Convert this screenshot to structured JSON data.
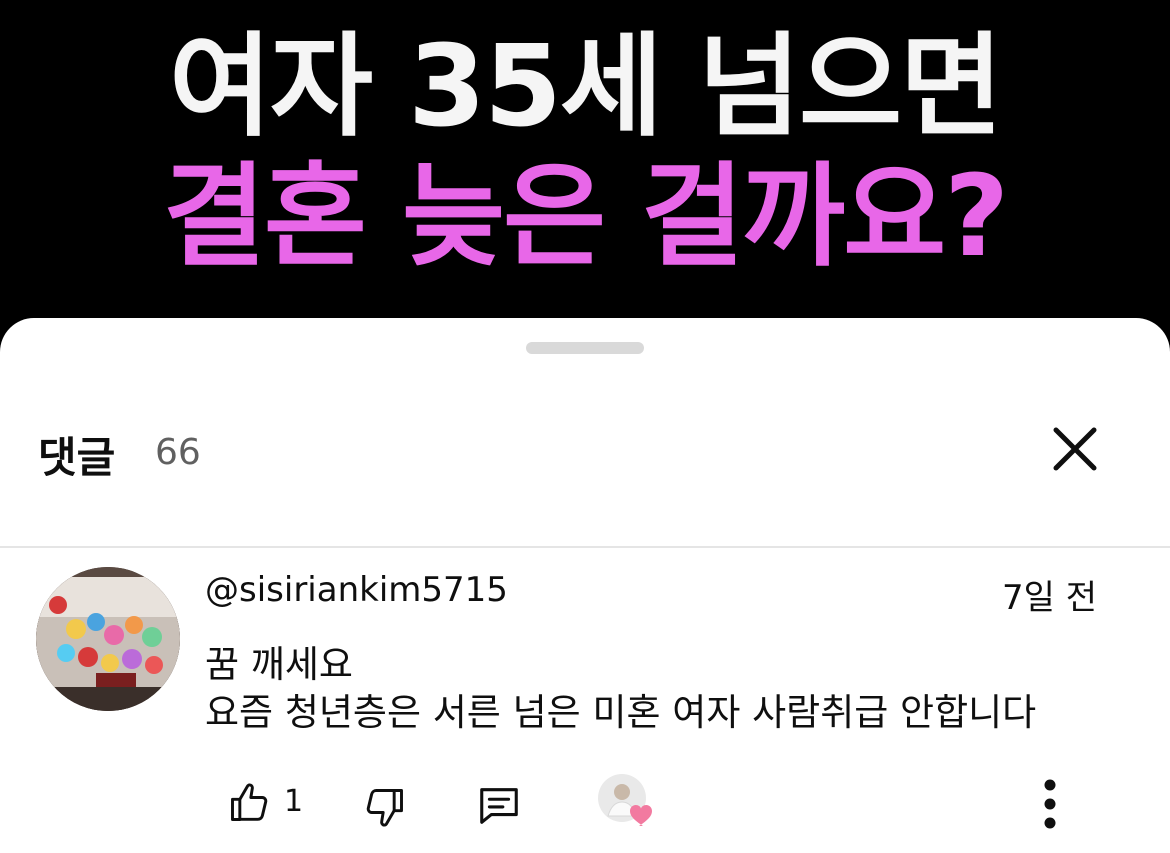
{
  "banner": {
    "line1": "여자 35세 넘으면",
    "line2": "결혼 늦은 걸까요?",
    "line2_color": "#e867e8"
  },
  "comments_sheet": {
    "title": "댓글",
    "count": "66",
    "close_icon": "close-icon"
  },
  "comment": {
    "username": "@sisiriankim5715",
    "time": "7일 전",
    "lines": [
      "꿈 깨세요",
      "요즘 청년층은 서른 넘은 미혼 여자 사람취급 안합니다"
    ],
    "like_count": "1",
    "icons": [
      "thumb-up-icon",
      "thumb-down-icon",
      "reply-icon",
      "creator-heart-icon",
      "more-vert-icon"
    ]
  }
}
